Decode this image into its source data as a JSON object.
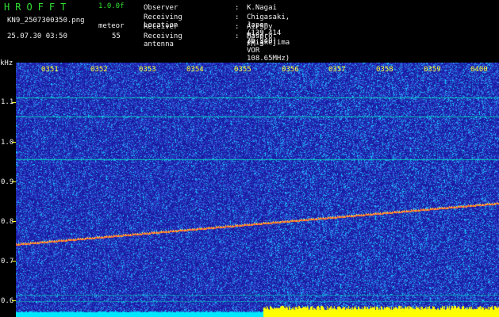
{
  "header": {
    "app_title": "HROFFT",
    "version": "1.0.0f",
    "file_name": "KN9_2507300350.png",
    "meteor_label": "meteor",
    "timestamp": "25.07.30 03:50",
    "meteor_count": "55"
  },
  "info": {
    "rows": [
      {
        "key": "Observer",
        "value": "K.Nagai"
      },
      {
        "key": "Receiving Location",
        "value": "Chigasaki, Japan (139.414 35.340)"
      },
      {
        "key": "Receiver",
        "value": "AirSpy mini (Miakejima VOR 108.65MHz)"
      },
      {
        "key": "Receiving antenna",
        "value": "Maspro FM-3"
      }
    ]
  },
  "axes": {
    "y_unit": "kHz",
    "y_ticks": [
      "1.1",
      "1.0",
      "0.9",
      "0.8",
      "0.7",
      "0.6"
    ],
    "x_ticks": [
      "0351",
      "0352",
      "0353",
      "0354",
      "0355",
      "0356",
      "0357",
      "0358",
      "0359",
      "0400"
    ]
  },
  "colors": {
    "background": "#1a1aa0",
    "noise_low": "#2a3cc8",
    "noise_high": "#18c8ff",
    "trace": "#ffa020",
    "tone_line": "#00ffc0",
    "level_bar": "#ffff00",
    "level_bar_low": "#00e8ff"
  }
}
